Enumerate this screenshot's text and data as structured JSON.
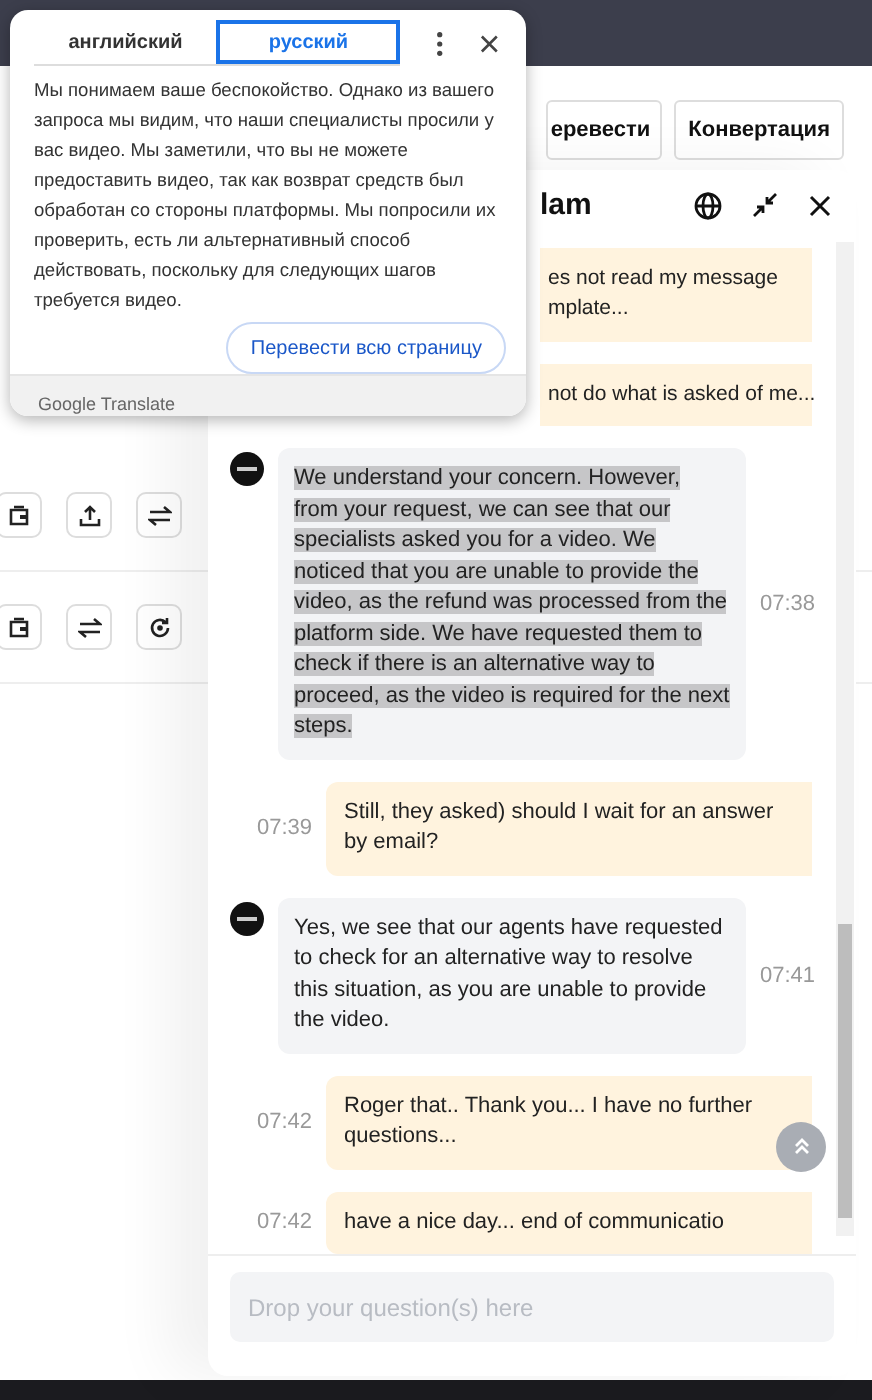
{
  "page": {
    "buttons": [
      "еревести",
      "Конвертация"
    ],
    "action_rows": [
      [
        {
          "kind": "wallet"
        },
        {
          "kind": "upload"
        },
        {
          "kind": "swap"
        }
      ],
      [
        {
          "kind": "wallet"
        },
        {
          "kind": "swap"
        },
        {
          "kind": "refresh"
        }
      ]
    ]
  },
  "chat": {
    "title": "lam",
    "messages": [
      {
        "kind": "user_cut",
        "lines": [
          "es not read my message",
          "mplate..."
        ]
      },
      {
        "kind": "user_cut",
        "lines": [
          "not do what is asked of me..."
        ]
      },
      {
        "kind": "agent",
        "highlighted": true,
        "time": "07:38",
        "text": "We understand your concern. However, from your request, we can see that our specialists asked you for a video. We noticed that you are unable to provide the video, as the refund was processed from the platform side. We have requested them to check if there is an alternative way to proceed, as the video is required for the next steps."
      },
      {
        "kind": "user",
        "time": "07:39",
        "text": "Still, they asked) should I wait for an answer by email?"
      },
      {
        "kind": "agent",
        "highlighted": false,
        "time": "07:41",
        "text": "Yes, we see that our agents have requested to check for an alternative way to resolve this situation, as you are unable to provide the video."
      },
      {
        "kind": "user",
        "time": "07:42",
        "text": "Roger that.. Thank you... I have no further questions..."
      },
      {
        "kind": "user",
        "time": "07:42",
        "text": "have a nice day... end of communicatio"
      }
    ],
    "input": {
      "placeholder": "Drop your question(s) here"
    }
  },
  "translate_popup": {
    "tabs": [
      {
        "label": "английский",
        "selected": false
      },
      {
        "label": "русский",
        "selected": true
      }
    ],
    "text": "Мы понимаем ваше беспокойство. Однако из вашего запроса мы видим, что наши специалисты просили у вас видео. Мы заметили, что вы не можете предоставить видео, так как возврат средств был обработан со стороны платформы. Мы попросили их проверить, есть ли альтернативный способ действовать, поскольку для следующих шагов требуется видео.",
    "button": "Перевести всю страницу",
    "footer": "Google Translate"
  }
}
